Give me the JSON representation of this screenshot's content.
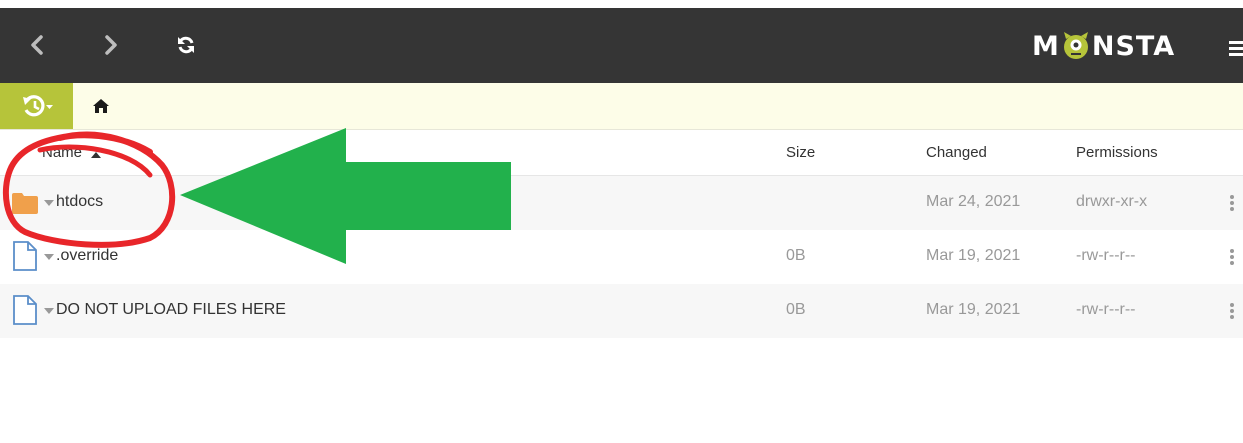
{
  "toolbar": {
    "back_icon": "chevron-left-icon",
    "forward_icon": "chevron-right-icon",
    "refresh_icon": "refresh-icon",
    "menu_icon": "hamburger-menu-icon"
  },
  "logo": {
    "before": "M",
    "after": "NSTA"
  },
  "breadcrumb": {
    "history_icon": "history-icon",
    "home_icon": "home-icon"
  },
  "table": {
    "columns": {
      "name": "Name",
      "size": "Size",
      "changed": "Changed",
      "permissions": "Permissions"
    },
    "sort": {
      "column": "name",
      "direction": "ascending"
    },
    "rows": [
      {
        "type": "folder",
        "icon": "folder-icon",
        "name": "htdocs",
        "size": "",
        "changed": "Mar 24, 2021",
        "permissions": "drwxr-xr-x"
      },
      {
        "type": "file",
        "icon": "file-icon",
        "name": ".override",
        "size": "0B",
        "changed": "Mar 19, 2021",
        "permissions": "-rw-r--r--"
      },
      {
        "type": "file",
        "icon": "file-icon",
        "name": "DO NOT UPLOAD FILES HERE",
        "size": "0B",
        "changed": "Mar 19, 2021",
        "permissions": "-rw-r--r--"
      }
    ]
  },
  "colors": {
    "topbar": "#353535",
    "accent": "#b6c43a",
    "breadcrumb_bg": "#fdfde8",
    "annotation_circle": "#e8262a",
    "annotation_arrow": "#22b14c",
    "folder": "#f0a04b",
    "file_outline": "#5b8ec9"
  }
}
